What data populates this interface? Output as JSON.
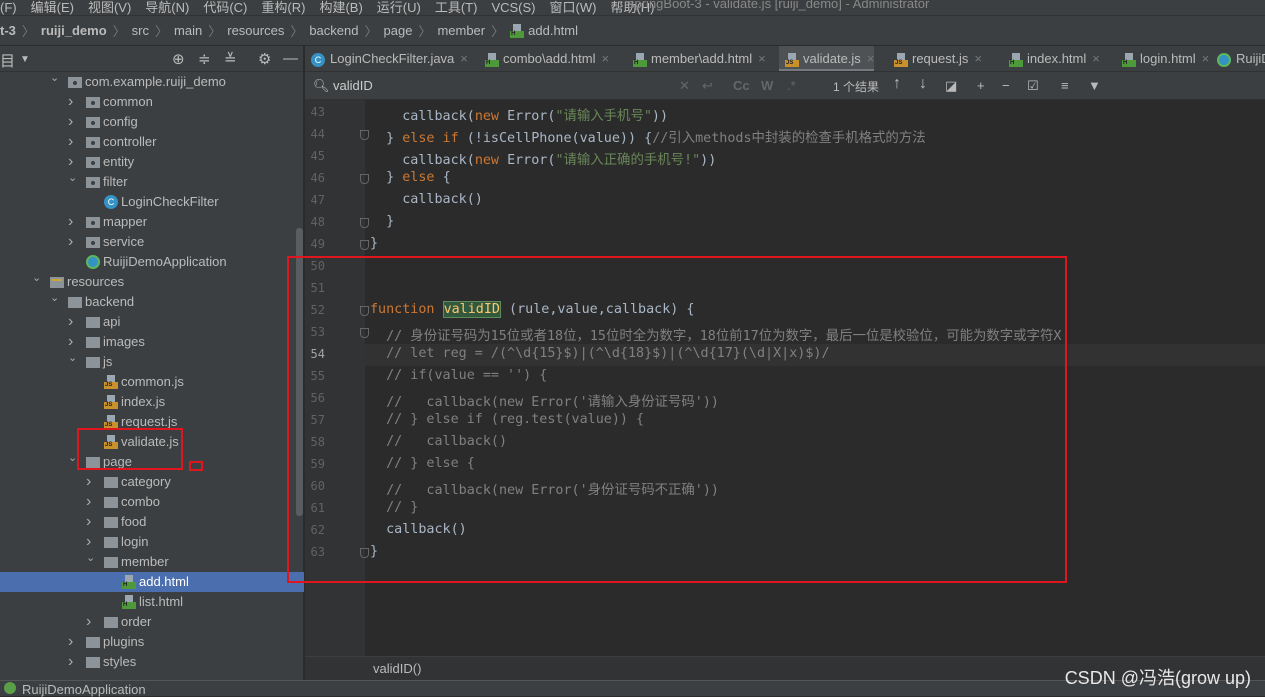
{
  "menu": [
    "(F)",
    "编辑(E)",
    "视图(V)",
    "导航(N)",
    "代码(C)",
    "重构(R)",
    "构建(B)",
    "运行(U)",
    "工具(T)",
    "VCS(S)",
    "窗口(W)",
    "帮助(H)"
  ],
  "window_title": "springBoot-3 - validate.js [ruiji_demo] - Administrator",
  "breadcrumb": [
    "t-3",
    "ruiji_demo",
    "src",
    "main",
    "resources",
    "backend",
    "page",
    "member",
    "add.html"
  ],
  "sidebar_title": "目",
  "tree": [
    {
      "label": "com.example.ruiji_demo",
      "level": 0,
      "kind": "pkg",
      "exp": true
    },
    {
      "label": "common",
      "level": 1,
      "kind": "pkg",
      "exp": false
    },
    {
      "label": "config",
      "level": 1,
      "kind": "pkg",
      "exp": false
    },
    {
      "label": "controller",
      "level": 1,
      "kind": "pkg",
      "exp": false
    },
    {
      "label": "entity",
      "level": 1,
      "kind": "pkg",
      "exp": false
    },
    {
      "label": "filter",
      "level": 1,
      "kind": "pkg",
      "exp": true
    },
    {
      "label": "LoginCheckFilter",
      "level": 2,
      "kind": "class"
    },
    {
      "label": "mapper",
      "level": 1,
      "kind": "pkg",
      "exp": false
    },
    {
      "label": "service",
      "level": 1,
      "kind": "pkg",
      "exp": false
    },
    {
      "label": "RuijiDemoApplication",
      "level": 1,
      "kind": "spring"
    },
    {
      "label": "resources",
      "level": -1,
      "kind": "res",
      "exp": true
    },
    {
      "label": "backend",
      "level": 0,
      "kind": "folder",
      "exp": true
    },
    {
      "label": "api",
      "level": 1,
      "kind": "folder",
      "exp": false
    },
    {
      "label": "images",
      "level": 1,
      "kind": "folder",
      "exp": false
    },
    {
      "label": "js",
      "level": 1,
      "kind": "folder",
      "exp": true
    },
    {
      "label": "common.js",
      "level": 2,
      "kind": "js"
    },
    {
      "label": "index.js",
      "level": 2,
      "kind": "js"
    },
    {
      "label": "request.js",
      "level": 2,
      "kind": "js"
    },
    {
      "label": "validate.js",
      "level": 2,
      "kind": "js"
    },
    {
      "label": "page",
      "level": 1,
      "kind": "folder",
      "exp": true
    },
    {
      "label": "category",
      "level": 2,
      "kind": "folder",
      "exp": false
    },
    {
      "label": "combo",
      "level": 2,
      "kind": "folder",
      "exp": false
    },
    {
      "label": "food",
      "level": 2,
      "kind": "folder",
      "exp": false
    },
    {
      "label": "login",
      "level": 2,
      "kind": "folder",
      "exp": false
    },
    {
      "label": "member",
      "level": 2,
      "kind": "folder",
      "exp": true
    },
    {
      "label": "add.html",
      "level": 3,
      "kind": "html",
      "selected": true
    },
    {
      "label": "list.html",
      "level": 3,
      "kind": "html"
    },
    {
      "label": "order",
      "level": 2,
      "kind": "folder",
      "exp": false
    },
    {
      "label": "plugins",
      "level": 1,
      "kind": "folder",
      "exp": false
    },
    {
      "label": "styles",
      "level": 1,
      "kind": "folder",
      "exp": false
    }
  ],
  "tabs": [
    {
      "label": "LoginCheckFilter.java",
      "icon": "class"
    },
    {
      "label": "combo\\add.html",
      "icon": "html"
    },
    {
      "label": "member\\add.html",
      "icon": "html"
    },
    {
      "label": "validate.js",
      "icon": "js",
      "active": true
    },
    {
      "label": "request.js",
      "icon": "js"
    },
    {
      "label": "index.html",
      "icon": "html"
    },
    {
      "label": "login.html",
      "icon": "html"
    },
    {
      "label": "RuijiD",
      "icon": "spring"
    }
  ],
  "find": {
    "query": "validID",
    "options": [
      "Cc",
      "W",
      ".*"
    ],
    "result": "1 个结果"
  },
  "code": [
    {
      "n": 43,
      "t": [
        [
          "    callback(",
          ""
        ],
        [
          "new ",
          "kw"
        ],
        [
          "Error(",
          ""
        ],
        [
          "\"请输入手机号\"",
          "str"
        ],
        [
          "))",
          ""
        ]
      ]
    },
    {
      "n": 44,
      "t": [
        [
          "  } ",
          ""
        ],
        [
          "else if ",
          "kw"
        ],
        [
          "(!isCellPhone(value)) {",
          ""
        ],
        [
          "//引入methods中封装的检查手机格式的方法",
          "cmt"
        ]
      ]
    },
    {
      "n": 45,
      "t": [
        [
          "    callback(",
          ""
        ],
        [
          "new ",
          "kw"
        ],
        [
          "Error(",
          ""
        ],
        [
          "\"请输入正确的手机号!\"",
          "str"
        ],
        [
          "))",
          ""
        ]
      ]
    },
    {
      "n": 46,
      "t": [
        [
          "  } ",
          ""
        ],
        [
          "else ",
          "kw"
        ],
        [
          "{",
          ""
        ]
      ]
    },
    {
      "n": 47,
      "t": [
        [
          "    callback()",
          ""
        ]
      ]
    },
    {
      "n": 48,
      "t": [
        [
          "  }",
          ""
        ]
      ]
    },
    {
      "n": 49,
      "t": [
        [
          "}",
          ""
        ]
      ]
    },
    {
      "n": 50,
      "t": []
    },
    {
      "n": 51,
      "t": []
    },
    {
      "n": 52,
      "t": [
        [
          "function ",
          "kw"
        ],
        [
          "validID",
          "hl"
        ],
        [
          " (rule,value,callback) {",
          ""
        ]
      ]
    },
    {
      "n": 53,
      "t": [
        [
          "  // 身份证号码为15位或者18位，15位时全为数字，18位前17位为数字，最后一位是校验位，可能为数字或字符X",
          "cmt"
        ]
      ]
    },
    {
      "n": 54,
      "t": [
        [
          "  // let reg = /(^\\d{15}$)|(^\\d{18}$)|(^\\d{17}(\\d|X|x)$)/",
          "cmt"
        ]
      ],
      "current": true
    },
    {
      "n": 55,
      "t": [
        [
          "  // if(value == '') {",
          "cmt"
        ]
      ]
    },
    {
      "n": 56,
      "t": [
        [
          "  //   callback(new Error('请输入身份证号码'))",
          "cmt"
        ]
      ]
    },
    {
      "n": 57,
      "t": [
        [
          "  // } else if (reg.test(value)) {",
          "cmt"
        ]
      ]
    },
    {
      "n": 58,
      "t": [
        [
          "  //   callback()",
          "cmt"
        ]
      ]
    },
    {
      "n": 59,
      "t": [
        [
          "  // } else {",
          "cmt"
        ]
      ]
    },
    {
      "n": 60,
      "t": [
        [
          "  //   callback(new Error('身份证号码不正确'))",
          "cmt"
        ]
      ]
    },
    {
      "n": 61,
      "t": [
        [
          "  // }",
          "cmt"
        ]
      ]
    },
    {
      "n": 62,
      "t": [
        [
          "  callback()",
          ""
        ]
      ]
    },
    {
      "n": 63,
      "t": [
        [
          "}",
          ""
        ]
      ]
    }
  ],
  "status_breadcrumb": "validID()",
  "run_tab": "RuijiDemoApplication",
  "watermark": "CSDN @冯浩(grow up)"
}
